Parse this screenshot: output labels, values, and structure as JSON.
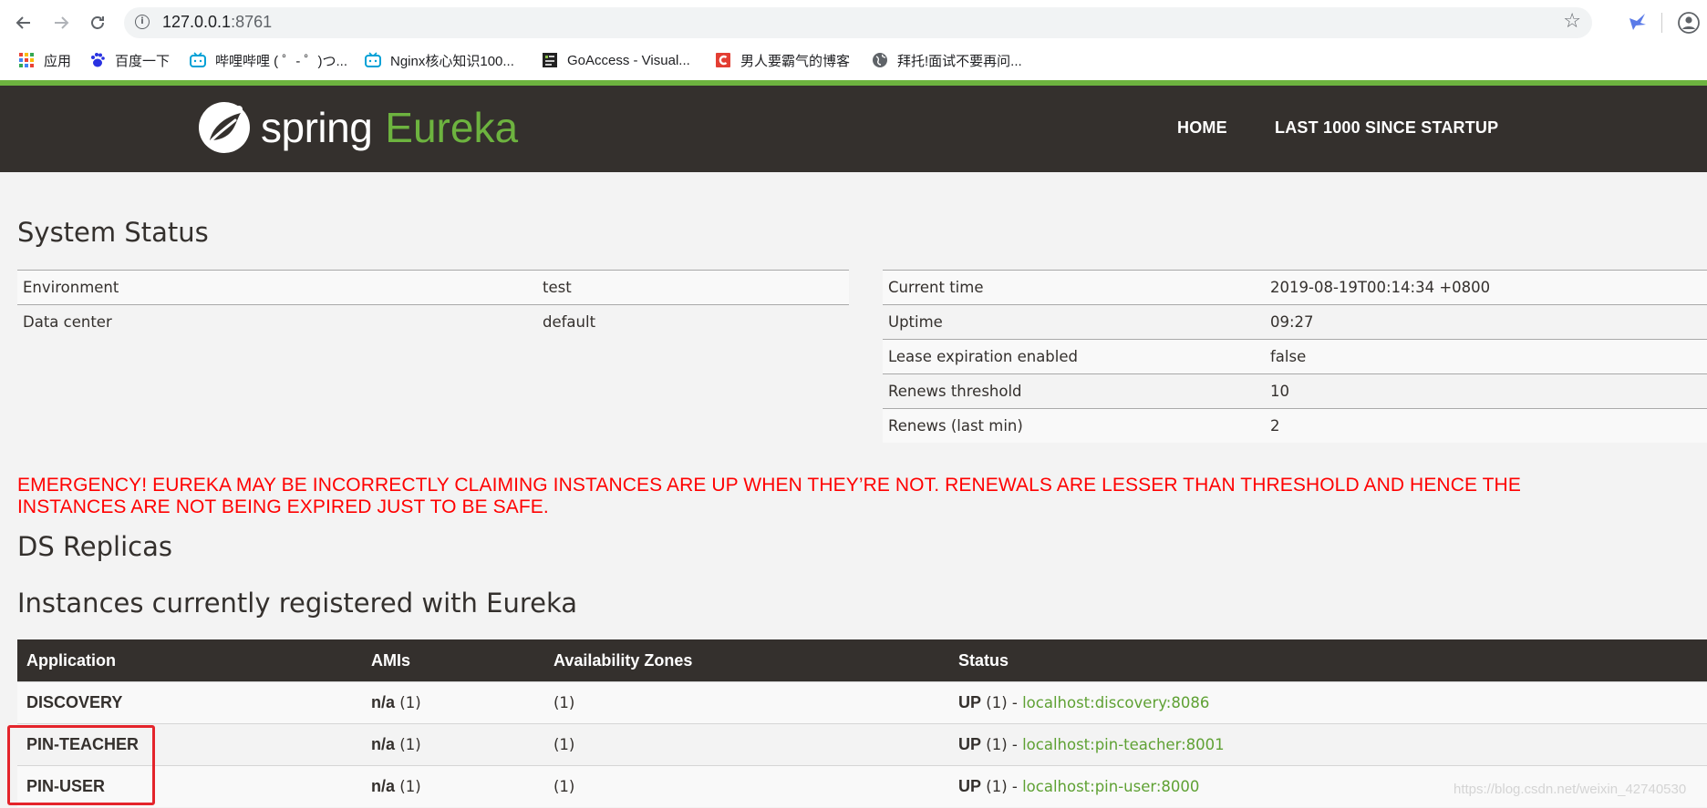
{
  "browser": {
    "url_host": "127.0.0.1",
    "url_port": ":8761",
    "bookmarks": [
      {
        "label": "应用",
        "icon": "apps-grid-icon"
      },
      {
        "label": "百度一下",
        "icon": "baidu-paw-icon"
      },
      {
        "label": "哔哩哔哩 ( ゜- ゜)つ...",
        "icon": "bilibili-tv-icon"
      },
      {
        "label": "Nginx核心知识100...",
        "icon": "bilibili-tv-icon"
      },
      {
        "label": "GoAccess - Visual...",
        "icon": "goaccess-icon"
      },
      {
        "label": "男人要霸气的博客",
        "icon": "csdn-c-icon"
      },
      {
        "label": "拜托!面试不要再问...",
        "icon": "globe-icon"
      }
    ]
  },
  "header": {
    "brand_spring": "spring",
    "brand_eureka": "Eureka",
    "nav": [
      "HOME",
      "LAST 1000 SINCE STARTUP"
    ]
  },
  "system_status": {
    "title": "System Status",
    "left": [
      {
        "label": "Environment",
        "value": "test"
      },
      {
        "label": "Data center",
        "value": "default"
      }
    ],
    "right": [
      {
        "label": "Current time",
        "value": "2019-08-19T00:14:34 +0800"
      },
      {
        "label": "Uptime",
        "value": "09:27"
      },
      {
        "label": "Lease expiration enabled",
        "value": "false"
      },
      {
        "label": "Renews threshold",
        "value": "10"
      },
      {
        "label": "Renews (last min)",
        "value": "2"
      }
    ]
  },
  "emergency_line1": "EMERGENCY! EUREKA MAY BE INCORRECTLY CLAIMING INSTANCES ARE UP WHEN THEY’RE NOT. RENEWALS ARE LESSER THAN THRESHOLD AND HENCE THE",
  "emergency_line2": "INSTANCES ARE NOT BEING EXPIRED JUST TO BE SAFE.",
  "ds_replicas_title": "DS Replicas",
  "instances": {
    "title": "Instances currently registered with Eureka",
    "columns": [
      "Application",
      "AMIs",
      "Availability Zones",
      "Status"
    ],
    "rows": [
      {
        "app": "DISCOVERY",
        "ami_na": "n/a",
        "ami_count": " (1)",
        "zones": "(1)",
        "status": "UP",
        "status_count": " (1) - ",
        "instance": "localhost:discovery:8086"
      },
      {
        "app": "PIN-TEACHER",
        "ami_na": "n/a",
        "ami_count": " (1)",
        "zones": "(1)",
        "status": "UP",
        "status_count": " (1) - ",
        "instance": "localhost:pin-teacher:8001"
      },
      {
        "app": "PIN-USER",
        "ami_na": "n/a",
        "ami_count": " (1)",
        "zones": "(1)",
        "status": "UP",
        "status_count": " (1) - ",
        "instance": "localhost:pin-user:8000"
      }
    ]
  },
  "watermark": "https://blog.csdn.net/weixin_42740530"
}
